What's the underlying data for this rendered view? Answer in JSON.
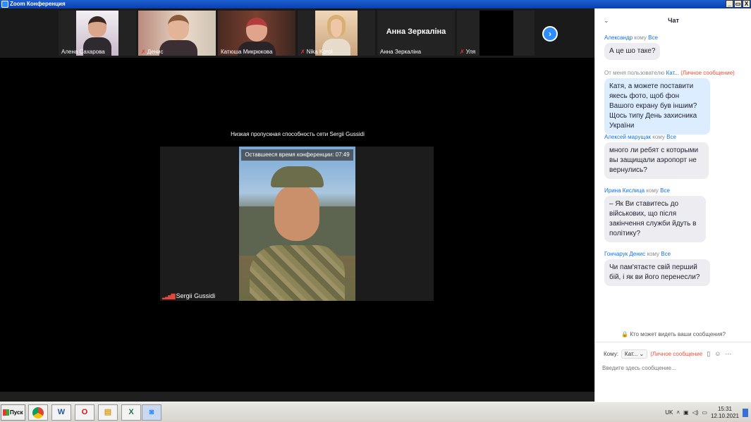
{
  "window": {
    "title": "Zoom Конференция",
    "buttons": [
      "_",
      "▭",
      "X"
    ]
  },
  "participants": [
    {
      "name": "Алена Сахарова",
      "muted": false,
      "type": "photo"
    },
    {
      "name": "Денис",
      "muted": true,
      "type": "photo"
    },
    {
      "name": "Катюша Микрюкова",
      "muted": false,
      "type": "photo"
    },
    {
      "name": "Nika Korol",
      "muted": true,
      "type": "photo"
    },
    {
      "name": "Анна Зеркаліна",
      "muted": false,
      "type": "name",
      "big_label": "Анна Зеркаліна"
    },
    {
      "name": "Уля",
      "muted": true,
      "type": "dark"
    }
  ],
  "next_icon": "chevron-right-icon",
  "main": {
    "network_notice": "Низкая пропускная способность сети Sergii Gussidi",
    "timer": "Оставшееся время конференции: 07:49",
    "speaker_name": "Sergii Gussidi"
  },
  "chat": {
    "title": "Чат",
    "messages": [
      {
        "sender": "Александр",
        "to_word": "кому",
        "to": "Все",
        "private": "",
        "text": "А це шо таке?",
        "mine": false
      },
      {
        "sender": "От меня пользователю",
        "to_word": "",
        "to": "Кат...",
        "private": "(Личное сообщение)",
        "text": "Катя, а можете поставити якесь фото, щоб фон Вашого екрану був іншим? Щось типу День захисника України",
        "mine": true
      },
      {
        "sender": "Алексей марущак",
        "to_word": "кому",
        "to": "Все",
        "private": "",
        "text": "много ли ребят с которыми вы защищали аэропорт не вернулись?",
        "mine": false
      },
      {
        "sender": "Ирина Кислица",
        "to_word": "кому",
        "to": "Все",
        "private": "",
        "text": "– Як Ви ставитесь до військових, що після закінчення служби йдуть в політику?",
        "mine": false
      },
      {
        "sender": "Гончарук Денис",
        "to_word": "кому",
        "to": "Все",
        "private": "",
        "text": "Чи пам'ятаєте свій перший бій, і як ви його перенесли?",
        "mine": false
      }
    ],
    "who_can_see": "Кто может видеть ваши сообщения?",
    "to_label": "Кому:",
    "to_selected": "Кат...",
    "private_label": "(Личное сообщение",
    "input_placeholder": "Введите здесь сообщение..."
  },
  "taskbar": {
    "start_label": "Пуск",
    "apps": [
      "chrome-icon",
      "word-icon",
      "opera-icon",
      "explorer-icon",
      "excel-icon",
      "zoom-icon"
    ],
    "language": "UK",
    "time": "15:31",
    "date": "12.10.2021"
  }
}
